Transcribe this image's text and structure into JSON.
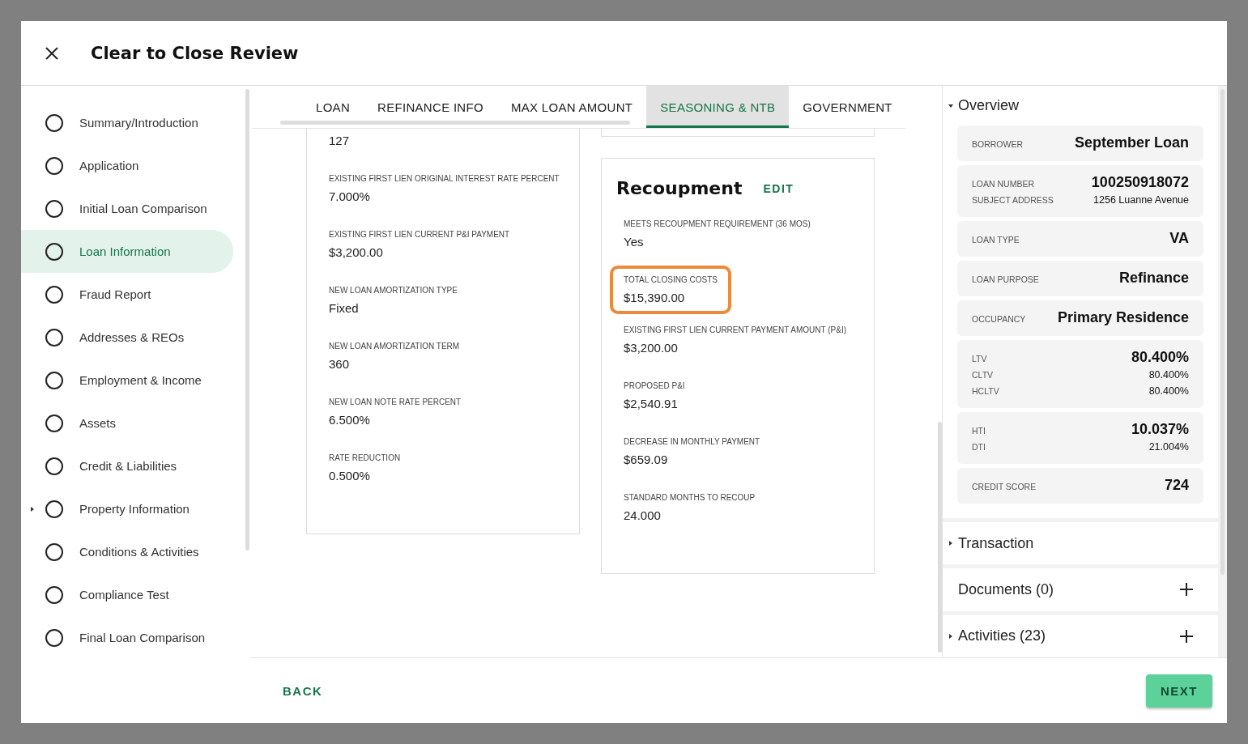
{
  "dialog": {
    "title": "Clear to Close Review"
  },
  "steps": [
    {
      "label": "Summary/Introduction",
      "selected": false,
      "expandable": false
    },
    {
      "label": "Application",
      "selected": false,
      "expandable": false
    },
    {
      "label": "Initial Loan Comparison",
      "selected": false,
      "expandable": false
    },
    {
      "label": "Loan Information",
      "selected": true,
      "expandable": false
    },
    {
      "label": "Fraud Report",
      "selected": false,
      "expandable": false
    },
    {
      "label": "Addresses & REOs",
      "selected": false,
      "expandable": false
    },
    {
      "label": "Employment & Income",
      "selected": false,
      "expandable": false
    },
    {
      "label": "Assets",
      "selected": false,
      "expandable": false
    },
    {
      "label": "Credit & Liabilities",
      "selected": false,
      "expandable": false
    },
    {
      "label": "Property Information",
      "selected": false,
      "expandable": true
    },
    {
      "label": "Conditions & Activities",
      "selected": false,
      "expandable": false
    },
    {
      "label": "Compliance Test",
      "selected": false,
      "expandable": false
    },
    {
      "label": "Final Loan Comparison",
      "selected": false,
      "expandable": false
    }
  ],
  "tabs": [
    {
      "label": "LOAN",
      "selected": false
    },
    {
      "label": "REFINANCE INFO",
      "selected": false
    },
    {
      "label": "MAX LOAN AMOUNT",
      "selected": false
    },
    {
      "label": "SEASONING & NTB",
      "selected": true
    },
    {
      "label": "GOVERNMENT",
      "selected": false
    }
  ],
  "loan_fields": [
    {
      "value": "127"
    },
    {
      "label": "EXISTING FIRST LIEN ORIGINAL INTEREST RATE PERCENT",
      "value": "7.000%"
    },
    {
      "label": "EXISTING FIRST LIEN CURRENT P&I PAYMENT",
      "value": "$3,200.00"
    },
    {
      "label": "NEW LOAN AMORTIZATION TYPE",
      "value": "Fixed"
    },
    {
      "label": "NEW LOAN AMORTIZATION TERM",
      "value": "360"
    },
    {
      "label": "NEW LOAN NOTE RATE PERCENT",
      "value": "6.500%"
    },
    {
      "label": "RATE REDUCTION",
      "value": "0.500%"
    }
  ],
  "recoupment": {
    "title": "Recoupment",
    "edit": "EDIT",
    "fields": [
      {
        "label": "MEETS RECOUPMENT REQUIREMENT (36 MOS)",
        "value": "Yes",
        "highlighted": false
      },
      {
        "label": "TOTAL CLOSING COSTS",
        "value": "$15,390.00",
        "highlighted": true
      },
      {
        "label": "EXISTING FIRST LIEN CURRENT PAYMENT AMOUNT (P&I)",
        "value": "$3,200.00",
        "highlighted": false
      },
      {
        "label": "PROPOSED P&I",
        "value": "$2,540.91",
        "highlighted": false
      },
      {
        "label": "DECREASE IN MONTHLY PAYMENT",
        "value": "$659.09",
        "highlighted": false
      },
      {
        "label": "STANDARD MONTHS TO RECOUP",
        "value": "24.000",
        "highlighted": false
      }
    ]
  },
  "overview": {
    "title": "Overview",
    "expanded": true,
    "cards": [
      {
        "rows": [
          {
            "label": "BORROWER",
            "value": "September Loan",
            "primary": true
          }
        ]
      },
      {
        "rows": [
          {
            "label": "LOAN NUMBER",
            "value": "100250918072",
            "primary": true
          },
          {
            "label": "SUBJECT ADDRESS",
            "value": "1256 Luanne Avenue",
            "primary": false
          }
        ]
      },
      {
        "rows": [
          {
            "label": "LOAN TYPE",
            "value": "VA",
            "primary": true
          }
        ]
      },
      {
        "rows": [
          {
            "label": "LOAN PURPOSE",
            "value": "Refinance",
            "primary": true
          }
        ]
      },
      {
        "rows": [
          {
            "label": "OCCUPANCY",
            "value": "Primary Residence",
            "primary": true
          }
        ]
      },
      {
        "rows": [
          {
            "label": "LTV",
            "value": "80.400%",
            "primary": true
          },
          {
            "label": "CLTV",
            "value": "80.400%",
            "primary": false
          },
          {
            "label": "HCLTV",
            "value": "80.400%",
            "primary": false
          }
        ]
      },
      {
        "rows": [
          {
            "label": "HTI",
            "value": "10.037%",
            "primary": true
          },
          {
            "label": "DTI",
            "value": "21.004%",
            "primary": false
          }
        ]
      },
      {
        "rows": [
          {
            "label": "CREDIT SCORE",
            "value": "724",
            "primary": true
          }
        ]
      }
    ]
  },
  "sections": [
    {
      "title": "Transaction",
      "expandable": true,
      "expanded": false,
      "addable": false
    },
    {
      "title": "Documents (0)",
      "expandable": false,
      "expanded": false,
      "addable": true
    },
    {
      "title": "Activities (23)",
      "expandable": true,
      "expanded": false,
      "addable": true
    }
  ],
  "footer": {
    "back": "BACK",
    "next": "NEXT"
  }
}
